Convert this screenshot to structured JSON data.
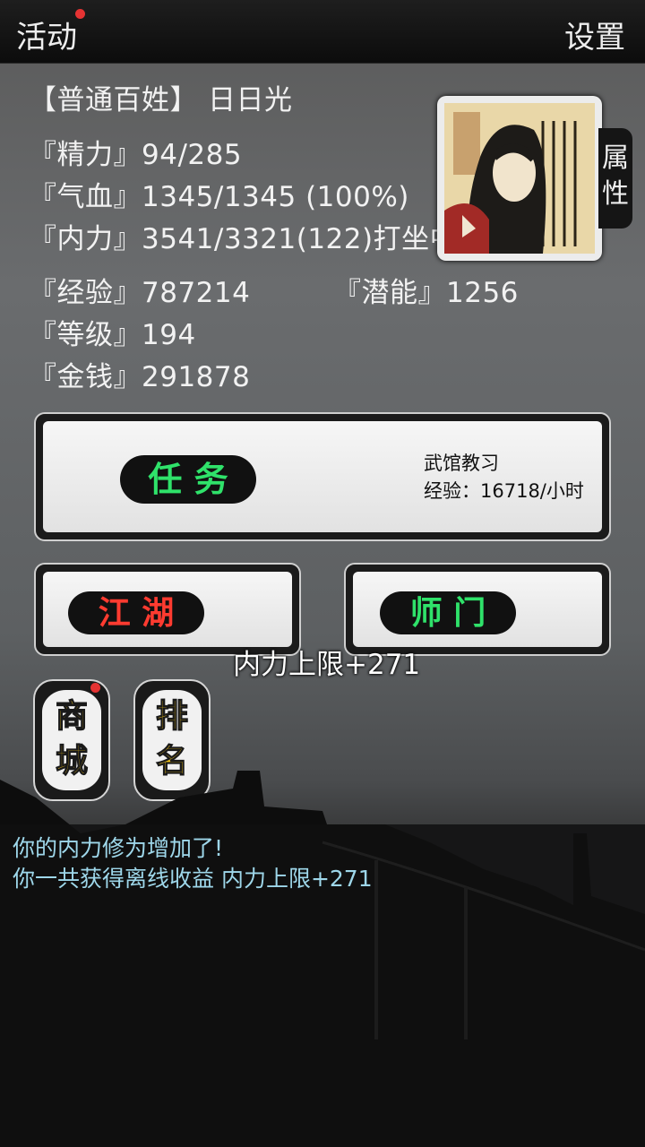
{
  "topbar": {
    "activity_label": "活动",
    "settings_label": "设置"
  },
  "player": {
    "title": "【普通百姓】",
    "name": "日日光",
    "stats": {
      "energy": "『精力』94/285",
      "hp": "『气血』1345/1345 (100%)",
      "inner_power": "『内力』3541/3321(122)打坐中",
      "experience": "『经验』787214",
      "potential": "『潜能』1256",
      "level": "『等级』194",
      "money": "『金钱』291878"
    }
  },
  "attributes_tab": {
    "line1": "属",
    "line2": "性"
  },
  "quest_button": {
    "label": "任 务",
    "task_name": "武馆教习",
    "task_exp": "经验：16718/小时",
    "label_color": "#2fe26a"
  },
  "jianghu_button": {
    "label": "江 湖",
    "label_color": "#ff3b30"
  },
  "sect_button": {
    "label": "师 门",
    "label_color": "#2fe26a"
  },
  "toast": "内力上限+271",
  "shop_button": {
    "line1": "商",
    "line2": "城"
  },
  "ranking_button": {
    "line1": "排",
    "line2": "名"
  },
  "log": {
    "line1": "你的内力修为增加了!",
    "line2": "你一共获得离线收益 内力上限+271"
  },
  "colors": {
    "notification_dot": "#e53333",
    "log_text": "#9ed7ea",
    "tag_text": "#f2c418"
  },
  "icons": {
    "portrait": "character-portrait",
    "notification": "red-dot-badge"
  }
}
